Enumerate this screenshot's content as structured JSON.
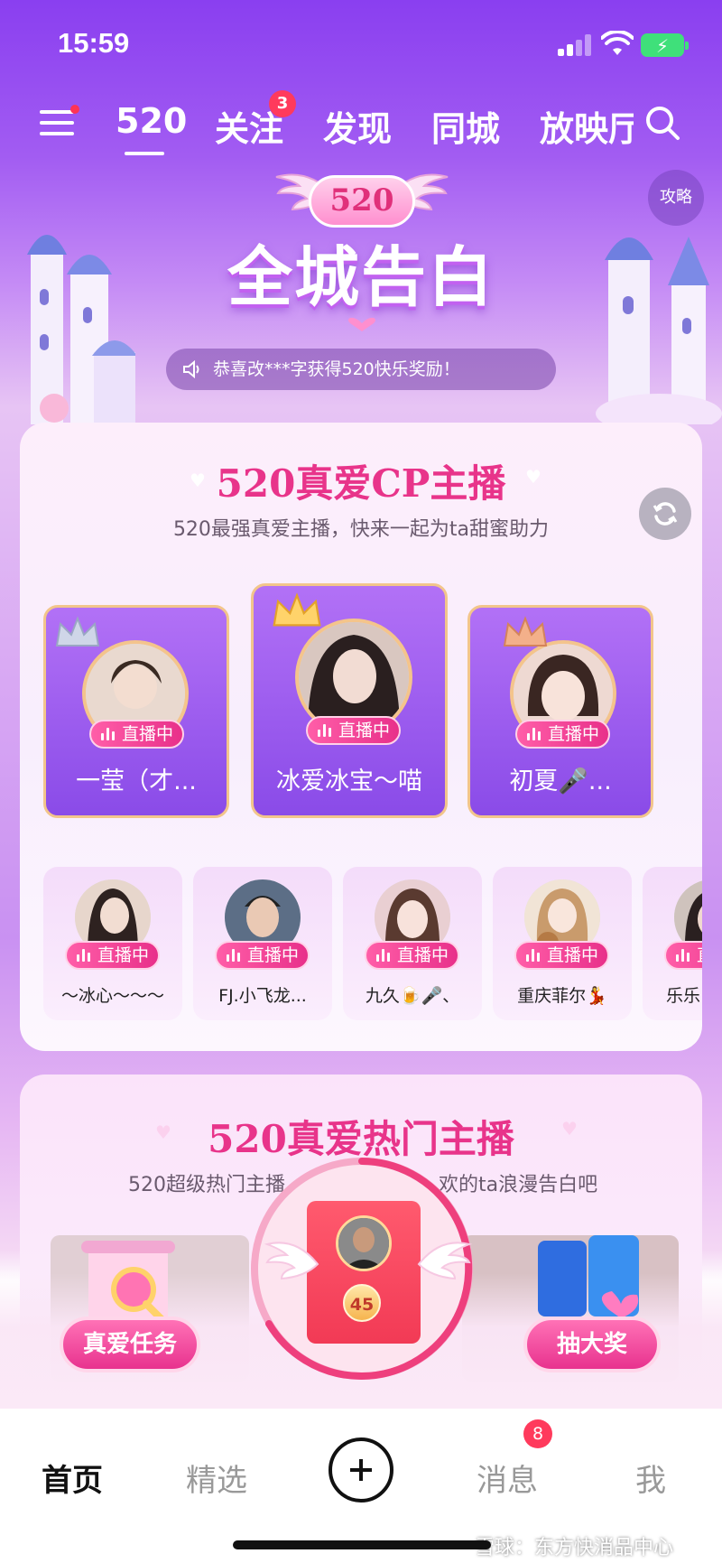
{
  "status": {
    "time": "15:59"
  },
  "top_nav": {
    "tabs": [
      {
        "label": "520",
        "active": true
      },
      {
        "label": "关注",
        "badge": "3"
      },
      {
        "label": "发现"
      },
      {
        "label": "同城"
      },
      {
        "label": "放映厅"
      }
    ]
  },
  "banner": {
    "badge": "520",
    "title": "全城告白",
    "strategy_label": "攻略",
    "notice": "恭喜改***字获得520快乐奖励！"
  },
  "cp_section": {
    "title": "520真爱CP主播",
    "subtitle": "520最强真爱主播，快来一起为ta甜蜜助力",
    "live_label": "直播中",
    "featured": [
      {
        "name": "一莹（才..."
      },
      {
        "name": "冰爱冰宝～喵"
      },
      {
        "name": "初夏🎤..."
      }
    ],
    "others": [
      {
        "name": "～冰心～～～"
      },
      {
        "name": "FJ.小飞龙..."
      },
      {
        "name": "九久🍺🎤、"
      },
      {
        "name": "重庆菲尔💃"
      },
      {
        "name": "乐乐"
      }
    ]
  },
  "hot_section": {
    "title": "520真爱热门主播",
    "subtitle_left": "520超级热门主播",
    "subtitle_right": "欢的ta浪漫告白吧"
  },
  "actions": {
    "task_label": "真爱任务",
    "lottery_label": "抽大奖",
    "redpacket_count": "45"
  },
  "bottom_nav": {
    "home": "首页",
    "featured": "精选",
    "messages": "消息",
    "messages_badge": "8",
    "me": "我"
  },
  "watermark": "雪球：东方快消品中心",
  "colors": {
    "accent": "#e8348a",
    "purple": "#8a4be8",
    "badge_red": "#ff3a5c"
  }
}
